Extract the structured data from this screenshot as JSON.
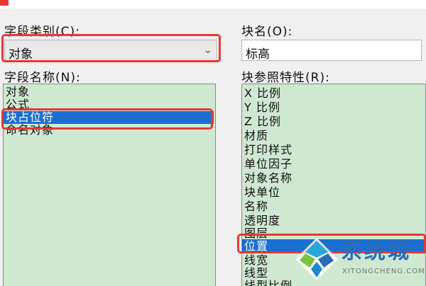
{
  "field_category": {
    "label": "字段类别(C):",
    "selected": "对象"
  },
  "block_name": {
    "label": "块名(O):",
    "value": "标高"
  },
  "field_names": {
    "label": "字段名称(N):",
    "items": [
      "对象",
      "公式",
      "块占位符",
      "命名对象"
    ],
    "selected": "块占位符"
  },
  "block_properties": {
    "label": "块参照特性(R):",
    "items": [
      "X 比例",
      "Y 比例",
      "Z 比例",
      "材质",
      "打印样式",
      "单位因子",
      "对象名称",
      "块单位",
      "名称",
      "透明度",
      "图层",
      "位置",
      "线宽",
      "线型",
      "线型比例"
    ],
    "selected": "位置"
  },
  "watermark": {
    "text": "系统城",
    "sub": "XITONGCHENG.COM"
  },
  "colors": {
    "highlight": "#e53935",
    "selection": "#1b6fd1",
    "list_bg": "#cfe8d1"
  }
}
